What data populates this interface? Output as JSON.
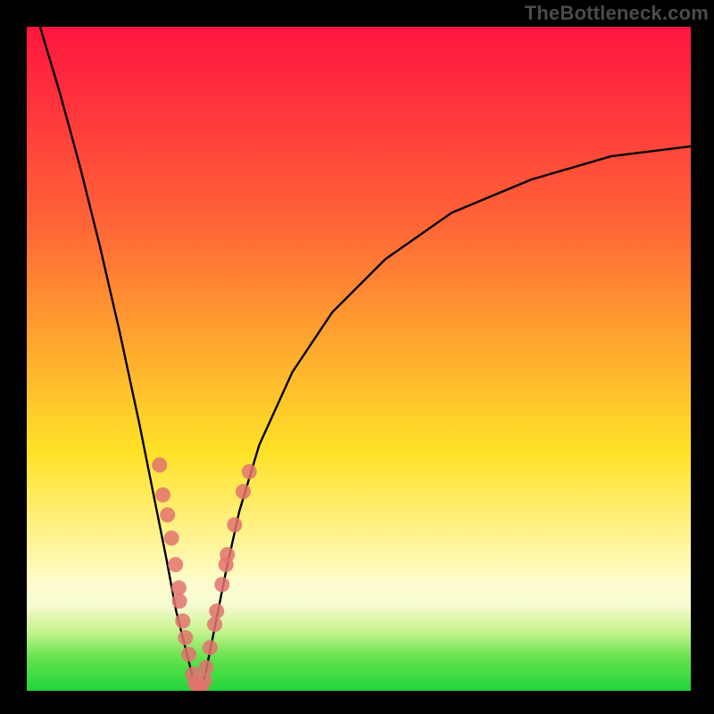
{
  "watermark": "TheBottleneck.com",
  "colors": {
    "curve_stroke": "#000000",
    "marker_fill": "#e2736e",
    "marker_stroke": "#e2736e",
    "background_black": "#000000"
  },
  "chart_data": {
    "type": "line",
    "title": "",
    "xlabel": "",
    "ylabel": "",
    "xlim": [
      0,
      100
    ],
    "ylim": [
      0,
      100
    ],
    "gradient_meaning": "red=high bottleneck, green=balanced",
    "series": [
      {
        "name": "bottleneck-curve",
        "comment": "V-shaped curve; y expressed as 0=bottom(green) to 100=top(red)",
        "x": [
          2,
          5,
          8,
          11,
          14,
          17,
          19,
          21,
          22.5,
          24,
          25,
          25.5,
          26,
          26.5,
          27,
          28,
          30,
          32,
          35,
          40,
          46,
          54,
          64,
          76,
          88,
          100
        ],
        "y": [
          100,
          90,
          79,
          67,
          54,
          40,
          30,
          20,
          12,
          6,
          2,
          0.5,
          0.5,
          1,
          3,
          8,
          18,
          27,
          37,
          48,
          57,
          65,
          72,
          77,
          80.5,
          82
        ]
      }
    ],
    "markers": {
      "name": "highlighted-points",
      "comment": "salmon dots clustered on both flanks near the valley",
      "points_xy": [
        [
          20.0,
          34.0
        ],
        [
          21.2,
          26.5
        ],
        [
          20.5,
          29.5
        ],
        [
          21.8,
          23.0
        ],
        [
          22.4,
          19.0
        ],
        [
          22.9,
          15.5
        ],
        [
          23.0,
          13.5
        ],
        [
          23.5,
          10.5
        ],
        [
          23.9,
          8.0
        ],
        [
          24.4,
          5.5
        ],
        [
          25.0,
          2.5
        ],
        [
          25.3,
          1.2
        ],
        [
          25.8,
          0.6
        ],
        [
          26.3,
          0.6
        ],
        [
          26.8,
          1.6
        ],
        [
          27.0,
          3.5
        ],
        [
          27.6,
          6.5
        ],
        [
          28.3,
          10.0
        ],
        [
          28.6,
          12.0
        ],
        [
          29.4,
          16.0
        ],
        [
          30.0,
          19.0
        ],
        [
          30.2,
          20.5
        ],
        [
          31.3,
          25.0
        ],
        [
          32.6,
          30.0
        ],
        [
          33.5,
          33.0
        ]
      ]
    }
  }
}
